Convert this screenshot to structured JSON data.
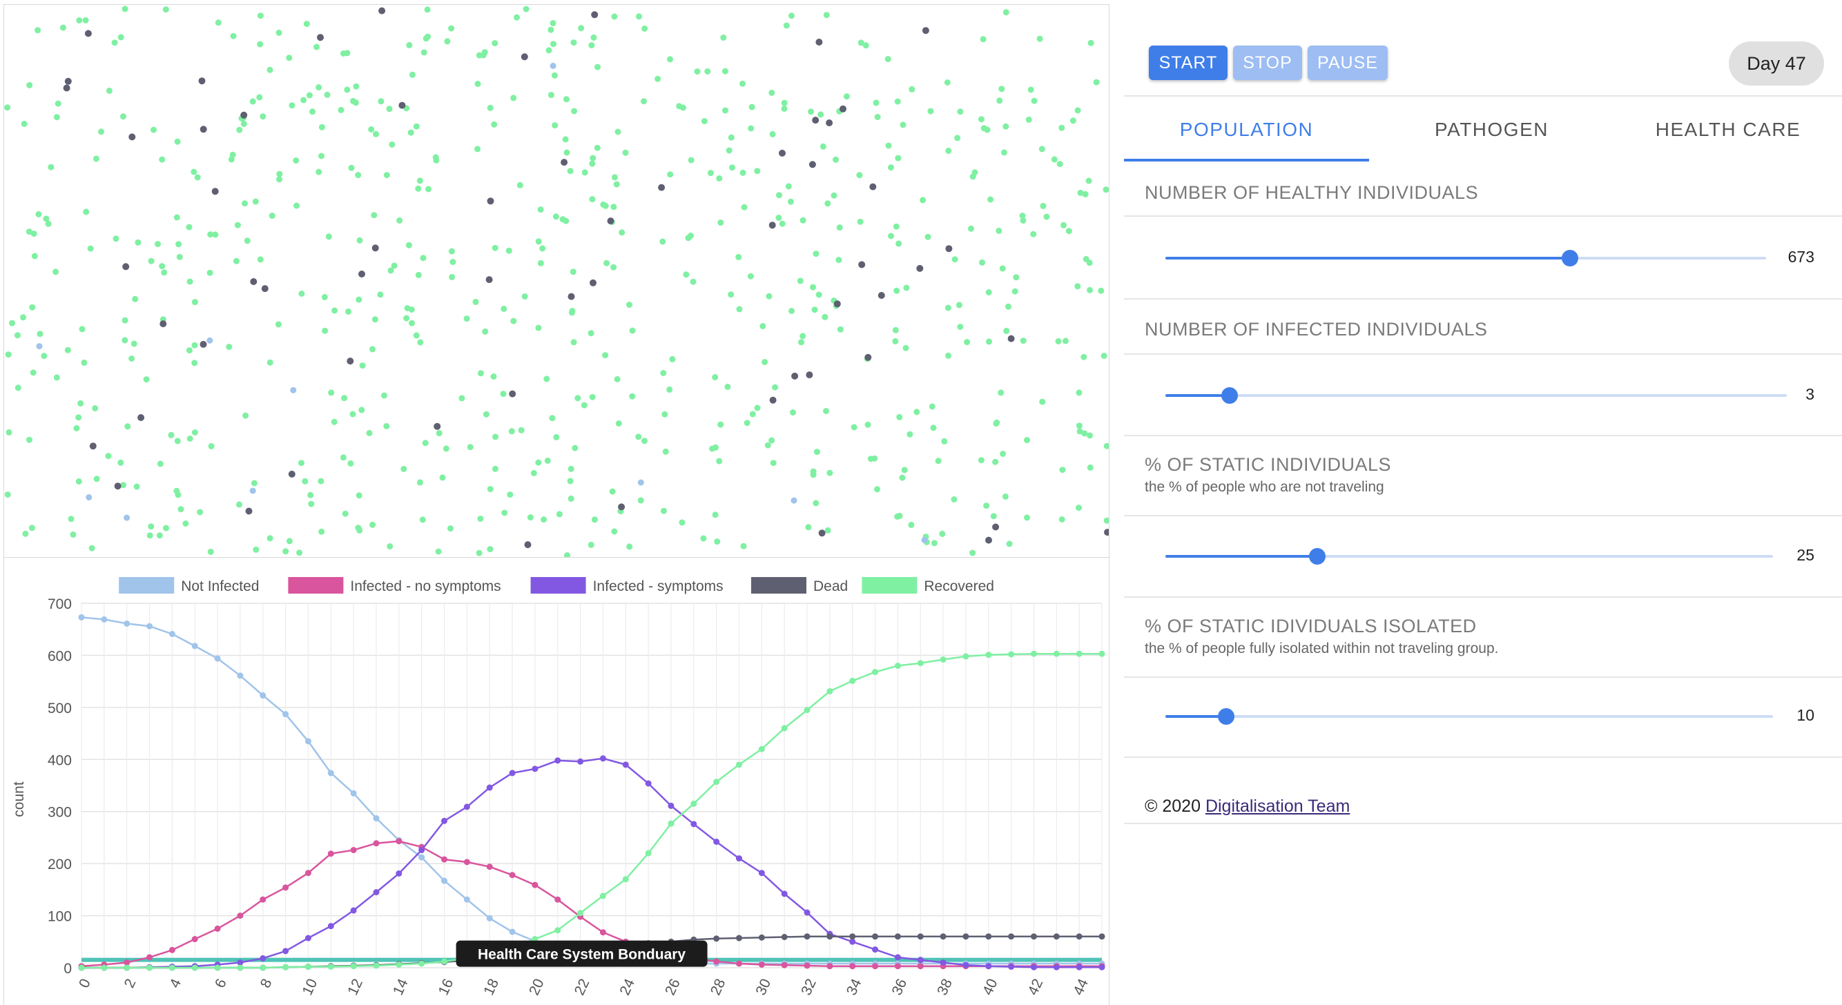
{
  "controls": {
    "start_label": "START",
    "stop_label": "STOP",
    "pause_label": "PAUSE",
    "day_label": "Day 47"
  },
  "tabs": [
    {
      "label": "POPULATION",
      "active": true
    },
    {
      "label": "PATHOGEN",
      "active": false
    },
    {
      "label": "HEALTH CARE",
      "active": false
    }
  ],
  "settings": {
    "healthy": {
      "title": "NUMBER OF HEALTHY INDIVIDUALS",
      "value": "673",
      "fraction": 0.673
    },
    "infected": {
      "title": "NUMBER OF INFECTED INDIVIDUALS",
      "value": "3",
      "fraction": 0.103
    },
    "static": {
      "title": "% OF STATIC INDIVIDUALS",
      "subtitle": "the % of people who are not traveling",
      "value": "25",
      "fraction": 0.25
    },
    "isolated": {
      "title": "% OF STATIC IDIVIDUALS ISOLATED",
      "subtitle": "the % of people fully isolated within not traveling group.",
      "value": "10",
      "fraction": 0.1
    }
  },
  "footer": {
    "copyright": "© 2020 ",
    "link_text": "Digitalisation Team"
  },
  "simulation": {
    "colors": {
      "not_infected": "#a0c4ea",
      "dead": "#5f5f72",
      "recovered": "#7ff0a2"
    },
    "counts": {
      "recovered": 603,
      "dead": 60,
      "not_infected": 10
    },
    "seed": 47
  },
  "chart_data": {
    "type": "line",
    "legend_position": "top",
    "ylabel": "count",
    "xlabel": "",
    "ylim": [
      0,
      700
    ],
    "yticks": [
      0,
      100,
      200,
      300,
      400,
      500,
      600,
      700
    ],
    "xticks": [
      0,
      2,
      4,
      6,
      8,
      10,
      12,
      14,
      16,
      18,
      20,
      22,
      24,
      26,
      28,
      30,
      32,
      34,
      36,
      38,
      40,
      42,
      44
    ],
    "x": [
      0,
      1,
      2,
      3,
      4,
      5,
      6,
      7,
      8,
      9,
      10,
      11,
      12,
      13,
      14,
      15,
      16,
      17,
      18,
      19,
      20,
      21,
      22,
      23,
      24,
      25,
      26,
      27,
      28,
      29,
      30,
      31,
      32,
      33,
      34,
      35,
      36,
      37,
      38,
      39,
      40,
      41,
      42,
      43,
      44,
      45
    ],
    "series": [
      {
        "name": "Not Infected",
        "color": "#a0c4ea",
        "values": [
          673,
          669,
          661,
          656,
          641,
          618,
          594,
          561,
          523,
          487,
          435,
          374,
          335,
          287,
          245,
          212,
          167,
          131,
          95,
          69,
          51,
          35,
          22,
          15,
          10,
          8,
          8,
          8,
          8,
          8,
          8,
          8,
          8,
          8,
          8,
          8,
          8,
          8,
          8,
          8,
          8,
          8,
          8,
          8,
          8,
          8
        ]
      },
      {
        "name": "Infected - no symptoms",
        "color": "#d9559d",
        "values": [
          3,
          6,
          10,
          20,
          34,
          55,
          75,
          100,
          131,
          154,
          182,
          219,
          226,
          239,
          243,
          232,
          208,
          203,
          194,
          178,
          159,
          131,
          98,
          68,
          50,
          41,
          28,
          18,
          12,
          8,
          6,
          5,
          4,
          3,
          3,
          3,
          3,
          3,
          3,
          3,
          3,
          3,
          3,
          3,
          3,
          3
        ]
      },
      {
        "name": "Infected - symptoms",
        "color": "#8258e2",
        "values": [
          0,
          0,
          0,
          1,
          2,
          3,
          6,
          10,
          18,
          32,
          57,
          80,
          110,
          145,
          181,
          226,
          282,
          309,
          346,
          374,
          382,
          398,
          396,
          402,
          390,
          354,
          311,
          276,
          242,
          210,
          182,
          142,
          106,
          65,
          50,
          35,
          20,
          15,
          10,
          5,
          3,
          2,
          1,
          1,
          1,
          1
        ]
      },
      {
        "name": "Dead",
        "color": "#5f5f72",
        "values": [
          0,
          0,
          0,
          0,
          0,
          0,
          0,
          0,
          0,
          1,
          2,
          3,
          4,
          5,
          7,
          9,
          11,
          14,
          18,
          22,
          27,
          31,
          36,
          40,
          44,
          47,
          50,
          54,
          56,
          57,
          58,
          59,
          60,
          60,
          60,
          60,
          60,
          60,
          60,
          60,
          60,
          60,
          60,
          60,
          60,
          60
        ]
      },
      {
        "name": "Recovered",
        "color": "#7ff0a2",
        "values": [
          0,
          0,
          0,
          0,
          0,
          0,
          0,
          0,
          0,
          1,
          2,
          2,
          3,
          4,
          6,
          8,
          12,
          18,
          26,
          38,
          55,
          72,
          105,
          138,
          170,
          220,
          277,
          315,
          357,
          390,
          420,
          460,
          495,
          531,
          551,
          568,
          580,
          585,
          592,
          598,
          601,
          602,
          603,
          603,
          603,
          603
        ]
      }
    ],
    "annotation": {
      "label": "Health Care System Bonduary",
      "y": 15,
      "color": "#4fc3b6"
    }
  }
}
